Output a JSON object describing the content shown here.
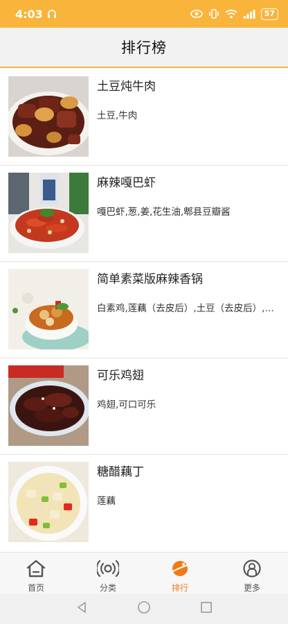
{
  "status_bar": {
    "time": "4:03",
    "battery": "57"
  },
  "header": {
    "title": "排行榜"
  },
  "recipes": [
    {
      "title": "土豆炖牛肉",
      "ingredients": "土豆,牛肉"
    },
    {
      "title": "麻辣嘎巴虾",
      "ingredients": "嘎巴虾,葱,姜,花生油,郫县豆瓣酱"
    },
    {
      "title": "简单素菜版麻辣香锅",
      "ingredients": "白素鸡,莲藕（去皮后）,土豆（去皮后）,藕片"
    },
    {
      "title": "可乐鸡翅",
      "ingredients": "鸡翅,可口可乐"
    },
    {
      "title": "糖醋藕丁",
      "ingredients": "莲藕"
    }
  ],
  "tabs": [
    {
      "label": "首页",
      "icon": "home-icon"
    },
    {
      "label": "分类",
      "icon": "broadcast-icon"
    },
    {
      "label": "排行",
      "icon": "planet-icon",
      "active": true
    },
    {
      "label": "更多",
      "icon": "user-circle-icon"
    }
  ],
  "colors": {
    "accent": "#f9b43b",
    "active_tab": "#ef7a1a"
  }
}
